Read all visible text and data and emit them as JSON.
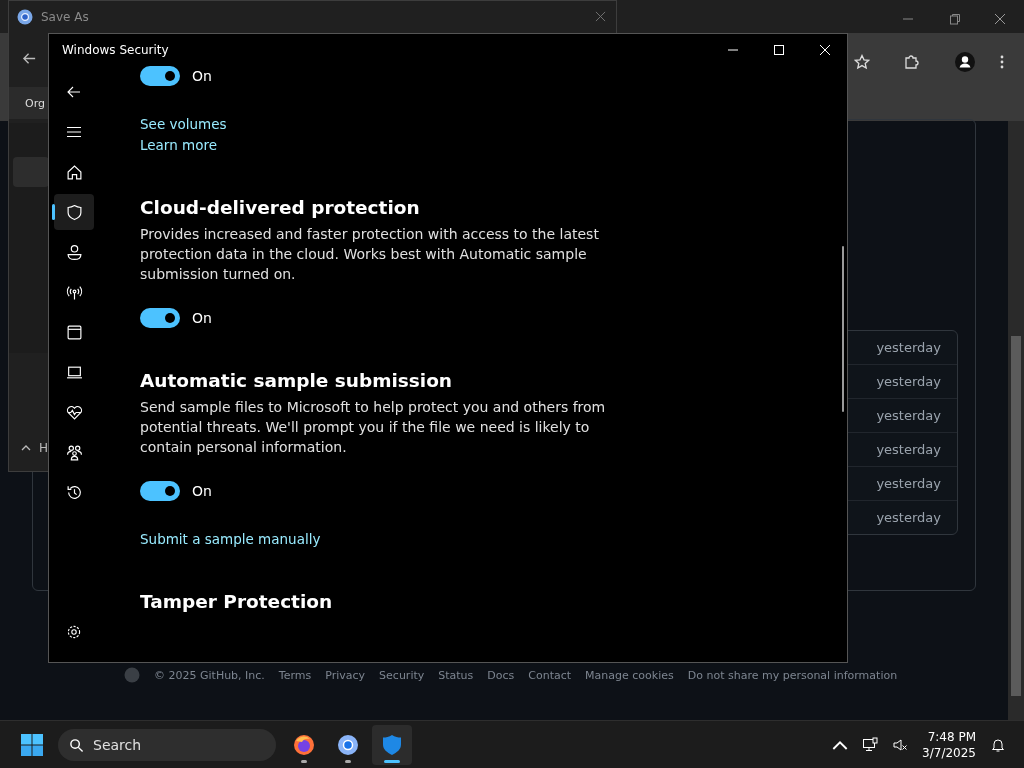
{
  "browser": {
    "rows": [
      {
        "time": "yesterday"
      },
      {
        "time": "yesterday"
      },
      {
        "time": "yesterday"
      },
      {
        "time": "yesterday"
      },
      {
        "time": "yesterday"
      },
      {
        "time": "yesterday"
      }
    ],
    "footer": {
      "copyright": "© 2025 GitHub, Inc.",
      "links": [
        "Terms",
        "Privacy",
        "Security",
        "Status",
        "Docs",
        "Contact",
        "Manage cookies",
        "Do not share my personal information"
      ]
    }
  },
  "save_dialog": {
    "title": "Save As",
    "toolbar_label": "Org",
    "section_label": "H"
  },
  "security_window": {
    "title": "Windows Security",
    "nav": [
      {
        "kind": "home",
        "selected": false
      },
      {
        "kind": "shield",
        "selected": true
      },
      {
        "kind": "account",
        "selected": false
      },
      {
        "kind": "network",
        "selected": false
      },
      {
        "kind": "app",
        "selected": false
      },
      {
        "kind": "device",
        "selected": false
      },
      {
        "kind": "health",
        "selected": false
      },
      {
        "kind": "family",
        "selected": false
      },
      {
        "kind": "history",
        "selected": false
      }
    ],
    "content": [
      {
        "kind": "toggle",
        "on": true,
        "label": "On"
      },
      {
        "kind": "link",
        "text": "See volumes"
      },
      {
        "kind": "link",
        "text": "Learn more"
      },
      {
        "kind": "heading",
        "text": "Cloud-delivered protection"
      },
      {
        "kind": "paragraph",
        "text": "Provides increased and faster protection with access to the latest protection data in the cloud. Works best with Automatic sample submission turned on."
      },
      {
        "kind": "toggle",
        "on": true,
        "label": "On"
      },
      {
        "kind": "heading",
        "text": "Automatic sample submission"
      },
      {
        "kind": "paragraph",
        "text": "Send sample files to Microsoft to help protect you and others from potential threats. We'll prompt you if the file we need is likely to contain personal information."
      },
      {
        "kind": "toggle",
        "on": true,
        "label": "On"
      },
      {
        "kind": "link",
        "text": "Submit a sample manually"
      },
      {
        "kind": "heading",
        "text": "Tamper Protection"
      }
    ]
  },
  "taskbar": {
    "search_placeholder": "Search",
    "apps": [
      {
        "kind": "firefox",
        "selected": false
      },
      {
        "kind": "chrome",
        "selected": false
      },
      {
        "kind": "security",
        "selected": true
      }
    ],
    "time": "7:48 PM",
    "date": "3/7/2025"
  }
}
